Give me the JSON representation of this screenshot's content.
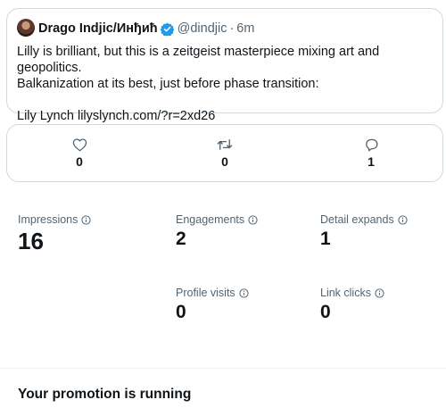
{
  "tweet": {
    "author_name": "Drago Indjic/Инђић",
    "handle": "@dindjic",
    "separator": "·",
    "time": "6m",
    "text_line1": "Lilly is brilliant, but this is a zeitgeist masterpiece mixing art and geopolitics.",
    "text_line2": "Balkanization at its best, just before phase transition:",
    "text_line3": "Lily Lynch lilyslynch.com/?r=2xd26"
  },
  "actions": {
    "like_count": "0",
    "retweet_count": "0",
    "reply_count": "1"
  },
  "metrics": {
    "impressions_label": "Impressions",
    "impressions_value": "16",
    "engagements_label": "Engagements",
    "engagements_value": "2",
    "detail_expands_label": "Detail expands",
    "detail_expands_value": "1",
    "profile_visits_label": "Profile visits",
    "profile_visits_value": "0",
    "link_clicks_label": "Link clicks",
    "link_clicks_value": "0"
  },
  "promotion": {
    "title": "Your promotion is running"
  },
  "colors": {
    "verified_blue": "#1d9bf0",
    "muted_text": "#536471",
    "border": "#cfd9de"
  }
}
